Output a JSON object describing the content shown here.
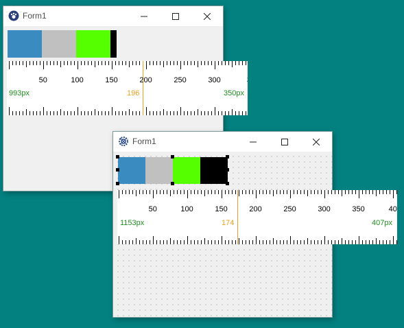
{
  "window1": {
    "title": "Form1",
    "icon": "paw-icon",
    "ruler": {
      "left_label": "993px",
      "marker_label": "196",
      "right_label": "350px",
      "ticks": [
        "50",
        "100",
        "150",
        "200",
        "250",
        "300",
        "3"
      ]
    }
  },
  "window2": {
    "title": "Form1",
    "icon": "gear-icon",
    "ruler": {
      "left_label": "1153px",
      "marker_label": "174",
      "right_label": "407px",
      "ticks": [
        "50",
        "100",
        "150",
        "200",
        "250",
        "300",
        "350",
        "40"
      ]
    }
  },
  "colors": {
    "desktop": "#038080",
    "swatch_blue": "#3a8cc0",
    "swatch_gray": "#c0c0c0",
    "swatch_green": "#55ff00",
    "swatch_black": "#000000",
    "marker": "#f0a020",
    "label_green": "#1f8f1f"
  }
}
